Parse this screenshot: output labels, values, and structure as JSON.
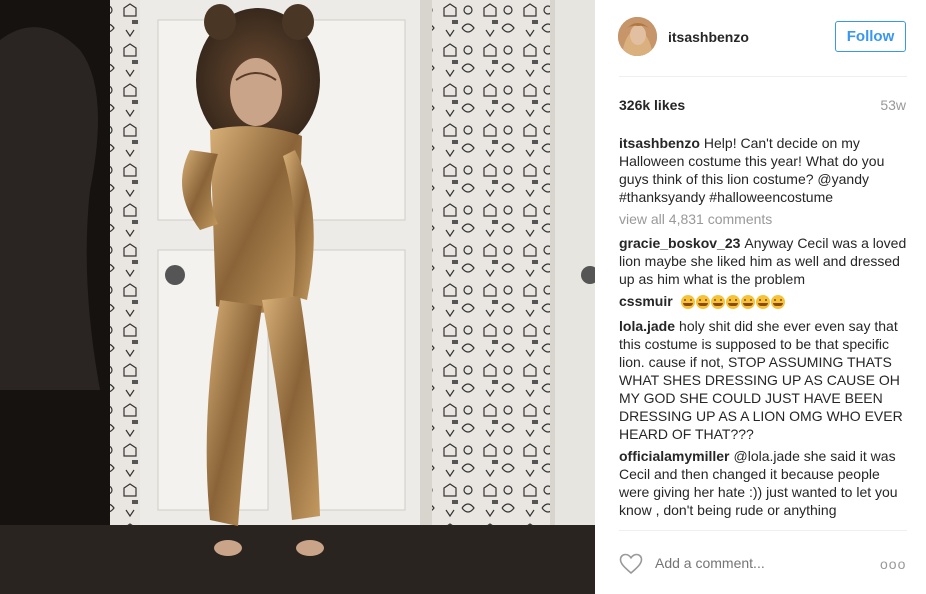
{
  "post": {
    "username": "itsashbenzo",
    "follow_label": "Follow",
    "likes": "326k likes",
    "age": "53w",
    "caption": {
      "user": "itsashbenzo",
      "text": "Help! Can't decide on my Halloween costume this year! What do you guys think of this lion costume? @yandy #thanksyandy #halloweencostume"
    },
    "view_all": "view all 4,831 comments",
    "comments": [
      {
        "user": "gracie_boskov_23",
        "text": "Anyway Cecil was a loved lion maybe she liked him as well and dressed up as him what is the problem"
      },
      {
        "user": "cssmuir",
        "text": "",
        "emoji_count": 7
      },
      {
        "user": "lola.jade",
        "text": "holy shit did she ever even say that this costume is supposed to be that specific lion. cause if not, STOP ASSUMING THATS WHAT SHES DRESSING UP AS CAUSE OH MY GOD SHE COULD JUST HAVE BEEN DRESSING UP AS A LION OMG WHO EVER HEARD OF THAT???"
      },
      {
        "user": "officialamymiller",
        "text": "@lola.jade she said it was Cecil and then changed it because people were giving her hate :)) just wanted to let you know , don't being rude or anything"
      }
    ],
    "add_comment_placeholder": "Add a comment...",
    "more_label": "ooo"
  },
  "colors": {
    "accent": "#3897f0",
    "muted": "#999999",
    "text": "#262626"
  },
  "icons": {
    "like": "heart-outline-icon",
    "more": "more-options-icon"
  }
}
